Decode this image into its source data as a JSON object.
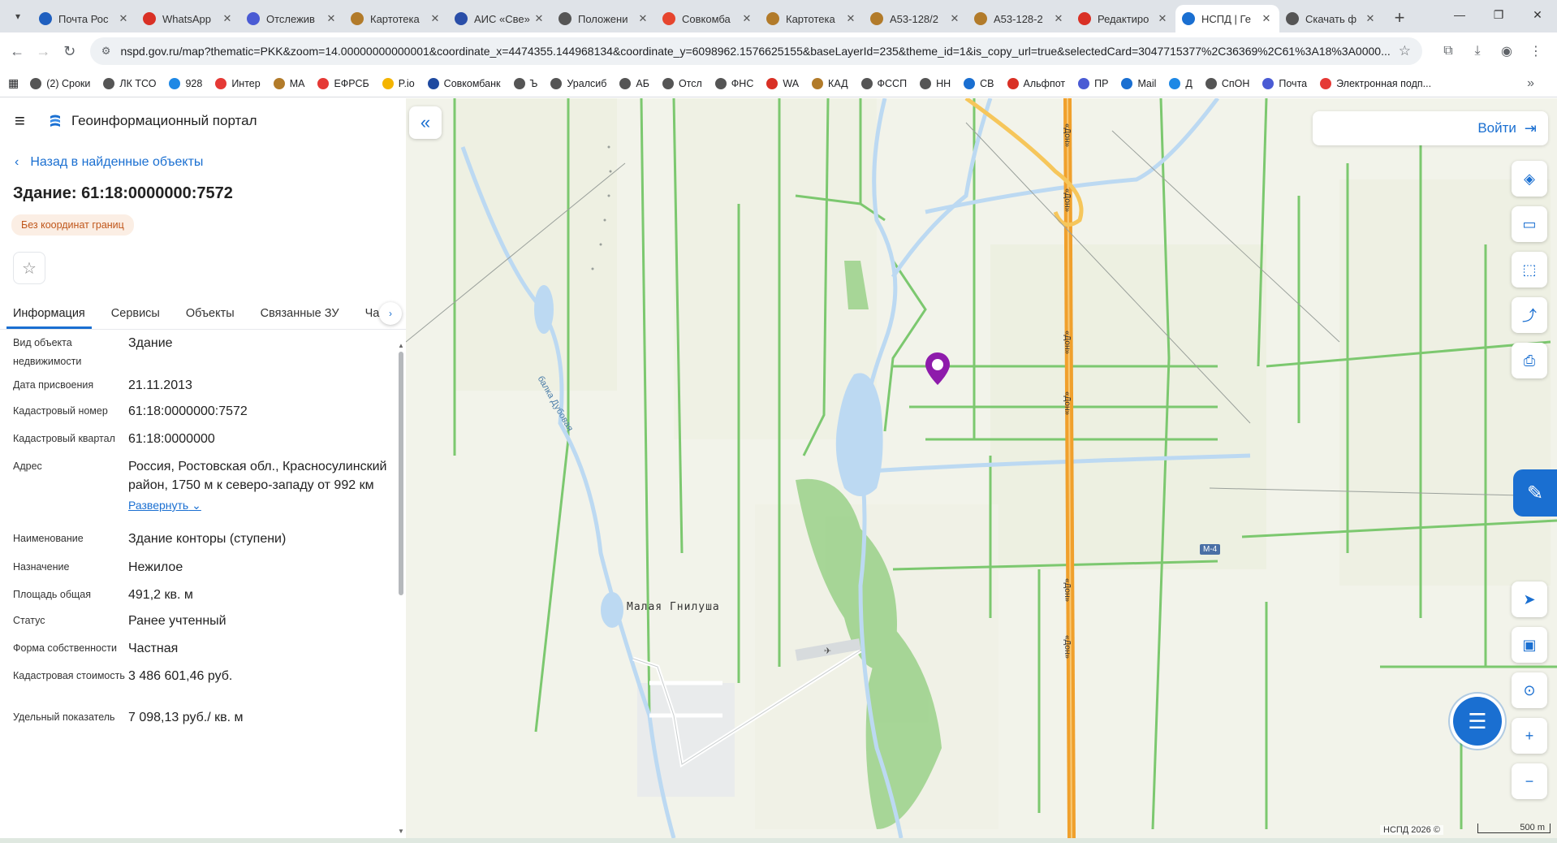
{
  "browser": {
    "tabs": [
      {
        "title": "Почта Рос",
        "color": "#1f5fbf",
        "active": false
      },
      {
        "title": "WhatsApp",
        "color": "#d93025",
        "active": false
      },
      {
        "title": "Отслежив",
        "color": "#4a5bd4",
        "active": false
      },
      {
        "title": "Картотека",
        "color": "#b27b2a",
        "active": false
      },
      {
        "title": "АИС «Све»",
        "color": "#2a4ea8",
        "active": false
      },
      {
        "title": "Положени",
        "color": "#555555",
        "active": false
      },
      {
        "title": "Совкомба",
        "color": "#e6452e",
        "active": false
      },
      {
        "title": "Картотека",
        "color": "#b27b2a",
        "active": false
      },
      {
        "title": "А53-128/2",
        "color": "#b27b2a",
        "active": false
      },
      {
        "title": "А53-128-2",
        "color": "#b27b2a",
        "active": false
      },
      {
        "title": "Редактиро",
        "color": "#d93025",
        "active": false
      },
      {
        "title": "НСПД | Ге",
        "color": "#1a6fd1",
        "active": true
      },
      {
        "title": "Скачать ф",
        "color": "#555555",
        "active": false
      }
    ],
    "url": "nspd.gov.ru/map?thematic=PKK&zoom=14.00000000000001&coordinate_x=4474355.144968134&coordinate_y=6098962.1576625155&baseLayerId=235&theme_id=1&is_copy_url=true&selectedCard=3047715377%2C36369%2C61%3A18%3A0000...",
    "bookmarks": [
      {
        "label": "(2) Сроки",
        "color": "#555555"
      },
      {
        "label": "ЛК ТСО",
        "color": "#555555"
      },
      {
        "label": "928",
        "color": "#1e88e5"
      },
      {
        "label": "Интер",
        "color": "#e53935"
      },
      {
        "label": "МА",
        "color": "#b27b2a"
      },
      {
        "label": "ЕФРСБ",
        "color": "#e53935"
      },
      {
        "label": "P.io",
        "color": "#f4b400"
      },
      {
        "label": "Совкомбанк",
        "color": "#1f4aa0"
      },
      {
        "label": "Ъ",
        "color": "#555555"
      },
      {
        "label": "Уралсиб",
        "color": "#555555"
      },
      {
        "label": "АБ",
        "color": "#555555"
      },
      {
        "label": "Отсл",
        "color": "#555555"
      },
      {
        "label": "ФНС",
        "color": "#555555"
      },
      {
        "label": "WA",
        "color": "#d93025"
      },
      {
        "label": "КАД",
        "color": "#b27b2a"
      },
      {
        "label": "ФССП",
        "color": "#555555"
      },
      {
        "label": "НН",
        "color": "#555555"
      },
      {
        "label": "СВ",
        "color": "#1a6fd1"
      },
      {
        "label": "Альфпот",
        "color": "#d93025"
      },
      {
        "label": "ПР",
        "color": "#4a5bd4"
      },
      {
        "label": "Mail",
        "color": "#1a6fd1"
      },
      {
        "label": "Д",
        "color": "#1e88e5"
      },
      {
        "label": "СпОН",
        "color": "#555555"
      },
      {
        "label": "Почта",
        "color": "#4a5bd4"
      },
      {
        "label": "Электронная подп...",
        "color": "#e53935"
      }
    ]
  },
  "portal": {
    "title": "Геоинформационный портал",
    "back_label": "Назад в найденные объекты",
    "object_title": "Здание: 61:18:0000000:7572",
    "badge": "Без координат границ",
    "tabs": [
      "Информация",
      "Сервисы",
      "Объекты",
      "Связанные ЗУ",
      "Ча"
    ],
    "expand_label": "Развернуть",
    "properties": [
      {
        "key": "Вид объекта недвижимости",
        "value": "Здание"
      },
      {
        "key": "Дата присвоения",
        "value": "21.11.2013"
      },
      {
        "key": "Кадастровый номер",
        "value": "61:18:0000000:7572"
      },
      {
        "key": "Кадастровый квартал",
        "value": "61:18:0000000"
      },
      {
        "key": "Адрес",
        "value": "Россия, Ростовская обл., Красносулинский район, 1750 м к северо-западу от 992 км"
      },
      {
        "key": "Наименование",
        "value": "Здание конторы (ступени)"
      },
      {
        "key": "Назначение",
        "value": "Нежилое"
      },
      {
        "key": "Площадь общая",
        "value": "491,2 кв. м"
      },
      {
        "key": "Статус",
        "value": "Ранее учтенный"
      },
      {
        "key": "Форма собственности",
        "value": "Частная"
      },
      {
        "key": "Кадастровая стоимость",
        "value": "3 486 601,46 руб."
      },
      {
        "key": "Удельный показатель",
        "value": "7 098,13 руб./ кв. м"
      }
    ]
  },
  "map": {
    "login_label": "Войти",
    "village_label": "Малая Гнилуша",
    "river_label": "балка Дубовая",
    "road_label": "«Дон»",
    "road_badge": "М-4",
    "copyright": "НСПД 2026 ©",
    "scale_label": "500 m",
    "colors": {
      "accent": "#1a6fd1",
      "marker": "#8e1bab",
      "road": "#f0a02c",
      "field_line": "#7cc86f",
      "water": "#bcd9f2"
    }
  }
}
